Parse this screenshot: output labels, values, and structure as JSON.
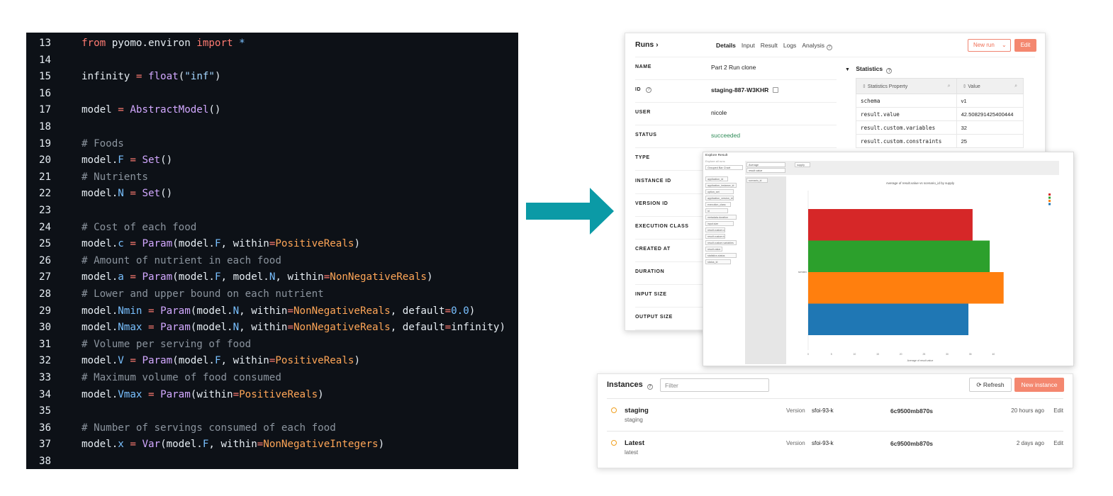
{
  "code": {
    "lines": [
      {
        "n": "13",
        "tokens": [
          [
            "kw",
            "from"
          ],
          [
            "pl",
            " pyomo.environ "
          ],
          [
            "kw",
            "import"
          ],
          [
            "pl",
            " "
          ],
          [
            "attr",
            "*"
          ]
        ]
      },
      {
        "n": "14",
        "tokens": []
      },
      {
        "n": "15",
        "tokens": [
          [
            "pl",
            "infinity "
          ],
          [
            "op",
            "="
          ],
          [
            "pl",
            " "
          ],
          [
            "fn",
            "float"
          ],
          [
            "pl",
            "("
          ],
          [
            "str",
            "\"inf\""
          ],
          [
            "pl",
            ")"
          ]
        ]
      },
      {
        "n": "16",
        "tokens": []
      },
      {
        "n": "17",
        "tokens": [
          [
            "pl",
            "model "
          ],
          [
            "op",
            "="
          ],
          [
            "pl",
            " "
          ],
          [
            "fn",
            "AbstractModel"
          ],
          [
            "pl",
            "()"
          ]
        ]
      },
      {
        "n": "18",
        "tokens": []
      },
      {
        "n": "19",
        "tokens": [
          [
            "cm",
            "# Foods"
          ]
        ]
      },
      {
        "n": "20",
        "tokens": [
          [
            "pl",
            "model."
          ],
          [
            "attr",
            "F"
          ],
          [
            "pl",
            " "
          ],
          [
            "op",
            "="
          ],
          [
            "pl",
            " "
          ],
          [
            "fn",
            "Set"
          ],
          [
            "pl",
            "()"
          ]
        ]
      },
      {
        "n": "21",
        "tokens": [
          [
            "cm",
            "# Nutrients"
          ]
        ]
      },
      {
        "n": "22",
        "tokens": [
          [
            "pl",
            "model."
          ],
          [
            "attr",
            "N"
          ],
          [
            "pl",
            " "
          ],
          [
            "op",
            "="
          ],
          [
            "pl",
            " "
          ],
          [
            "fn",
            "Set"
          ],
          [
            "pl",
            "()"
          ]
        ]
      },
      {
        "n": "23",
        "tokens": []
      },
      {
        "n": "24",
        "tokens": [
          [
            "cm",
            "# Cost of each food"
          ]
        ]
      },
      {
        "n": "25",
        "tokens": [
          [
            "pl",
            "model."
          ],
          [
            "attr",
            "c"
          ],
          [
            "pl",
            " "
          ],
          [
            "op",
            "="
          ],
          [
            "pl",
            " "
          ],
          [
            "fn",
            "Param"
          ],
          [
            "pl",
            "(model."
          ],
          [
            "attr",
            "F"
          ],
          [
            "pl",
            ", within"
          ],
          [
            "op",
            "="
          ],
          [
            "type",
            "PositiveReals"
          ],
          [
            "pl",
            ")"
          ]
        ]
      },
      {
        "n": "26",
        "tokens": [
          [
            "cm",
            "# Amount of nutrient in each food"
          ]
        ]
      },
      {
        "n": "27",
        "tokens": [
          [
            "pl",
            "model."
          ],
          [
            "attr",
            "a"
          ],
          [
            "pl",
            " "
          ],
          [
            "op",
            "="
          ],
          [
            "pl",
            " "
          ],
          [
            "fn",
            "Param"
          ],
          [
            "pl",
            "(model."
          ],
          [
            "attr",
            "F"
          ],
          [
            "pl",
            ", model."
          ],
          [
            "attr",
            "N"
          ],
          [
            "pl",
            ", within"
          ],
          [
            "op",
            "="
          ],
          [
            "type",
            "NonNegativeReals"
          ],
          [
            "pl",
            ")"
          ]
        ]
      },
      {
        "n": "28",
        "tokens": [
          [
            "cm",
            "# Lower and upper bound on each nutrient"
          ]
        ]
      },
      {
        "n": "29",
        "tokens": [
          [
            "pl",
            "model."
          ],
          [
            "attr",
            "Nmin"
          ],
          [
            "pl",
            " "
          ],
          [
            "op",
            "="
          ],
          [
            "pl",
            " "
          ],
          [
            "fn",
            "Param"
          ],
          [
            "pl",
            "(model."
          ],
          [
            "attr",
            "N"
          ],
          [
            "pl",
            ", within"
          ],
          [
            "op",
            "="
          ],
          [
            "type",
            "NonNegativeReals"
          ],
          [
            "pl",
            ", default"
          ],
          [
            "op",
            "="
          ],
          [
            "num",
            "0.0"
          ],
          [
            "pl",
            ")"
          ]
        ]
      },
      {
        "n": "30",
        "tokens": [
          [
            "pl",
            "model."
          ],
          [
            "attr",
            "Nmax"
          ],
          [
            "pl",
            " "
          ],
          [
            "op",
            "="
          ],
          [
            "pl",
            " "
          ],
          [
            "fn",
            "Param"
          ],
          [
            "pl",
            "(model."
          ],
          [
            "attr",
            "N"
          ],
          [
            "pl",
            ", within"
          ],
          [
            "op",
            "="
          ],
          [
            "type",
            "NonNegativeReals"
          ],
          [
            "pl",
            ", default"
          ],
          [
            "op",
            "="
          ],
          [
            "pl",
            "infinity)"
          ]
        ]
      },
      {
        "n": "31",
        "tokens": [
          [
            "cm",
            "# Volume per serving of food"
          ]
        ]
      },
      {
        "n": "32",
        "tokens": [
          [
            "pl",
            "model."
          ],
          [
            "attr",
            "V"
          ],
          [
            "pl",
            " "
          ],
          [
            "op",
            "="
          ],
          [
            "pl",
            " "
          ],
          [
            "fn",
            "Param"
          ],
          [
            "pl",
            "(model."
          ],
          [
            "attr",
            "F"
          ],
          [
            "pl",
            ", within"
          ],
          [
            "op",
            "="
          ],
          [
            "type",
            "PositiveReals"
          ],
          [
            "pl",
            ")"
          ]
        ]
      },
      {
        "n": "33",
        "tokens": [
          [
            "cm",
            "# Maximum volume of food consumed"
          ]
        ]
      },
      {
        "n": "34",
        "tokens": [
          [
            "pl",
            "model."
          ],
          [
            "attr",
            "Vmax"
          ],
          [
            "pl",
            " "
          ],
          [
            "op",
            "="
          ],
          [
            "pl",
            " "
          ],
          [
            "fn",
            "Param"
          ],
          [
            "pl",
            "(within"
          ],
          [
            "op",
            "="
          ],
          [
            "type",
            "PositiveReals"
          ],
          [
            "pl",
            ")"
          ]
        ]
      },
      {
        "n": "35",
        "tokens": []
      },
      {
        "n": "36",
        "tokens": [
          [
            "cm",
            "# Number of servings consumed of each food"
          ]
        ]
      },
      {
        "n": "37",
        "tokens": [
          [
            "pl",
            "model."
          ],
          [
            "attr",
            "x"
          ],
          [
            "pl",
            " "
          ],
          [
            "op",
            "="
          ],
          [
            "pl",
            " "
          ],
          [
            "fn",
            "Var"
          ],
          [
            "pl",
            "(model."
          ],
          [
            "attr",
            "F"
          ],
          [
            "pl",
            ", within"
          ],
          [
            "op",
            "="
          ],
          [
            "type",
            "NonNegativeIntegers"
          ],
          [
            "pl",
            ")"
          ]
        ]
      },
      {
        "n": "38",
        "tokens": []
      }
    ]
  },
  "arrow_color": "#0b9aa6",
  "runs": {
    "breadcrumb": "Runs",
    "tabs": [
      "Details",
      "Input",
      "Result",
      "Logs",
      "Analysis"
    ],
    "new_run_label": "New run",
    "edit_label": "Edit",
    "details": [
      {
        "label": "NAME",
        "value": "Part 2 Run clone"
      },
      {
        "label": "ID",
        "value": "staging-887-W3KHR"
      },
      {
        "label": "USER",
        "value": "nicole"
      },
      {
        "label": "STATUS",
        "value": "succeeded"
      },
      {
        "label": "TYPE",
        "value": ""
      },
      {
        "label": "INSTANCE ID",
        "value": ""
      },
      {
        "label": "VERSION ID",
        "value": ""
      },
      {
        "label": "EXECUTION CLASS",
        "value": ""
      },
      {
        "label": "CREATED AT",
        "value": ""
      },
      {
        "label": "DURATION",
        "value": ""
      },
      {
        "label": "INPUT SIZE",
        "value": ""
      },
      {
        "label": "OUTPUT SIZE",
        "value": ""
      }
    ],
    "statistics": {
      "title": "Statistics",
      "headers": [
        "Statistics Property",
        "Value"
      ],
      "rows": [
        [
          "schema",
          "v1"
        ],
        [
          "result.value",
          "42.508291425400444"
        ],
        [
          "result.custom.variables",
          "32"
        ],
        [
          "result.custom.constraints",
          "25"
        ]
      ]
    }
  },
  "explore": {
    "title": "Explore Result",
    "subtitle": "Explore all runs",
    "toolbar": {
      "agg": "Average",
      "field": "result.value",
      "group": "Grouped Bar Chart",
      "split": "supply",
      "scenario": "scenario_id"
    },
    "chips": [
      "application_id",
      "application_instance_id",
      "option_set",
      "application_version_id",
      "execution_class",
      "id",
      "metadata.duration",
      "input.size",
      "result.custom.constraints",
      "result.custom.total_grade",
      "result.custom.variables",
      "result.value",
      "statistics.status",
      "status_id"
    ],
    "chart_data": {
      "type": "bar",
      "title": "Average of result.value vs scenario_id by supply",
      "xlabel": "Average of result.value",
      "ylabel": "",
      "categories": [
        "scenario"
      ],
      "xlim": [
        0,
        45
      ],
      "x_ticks": [
        "0",
        "5",
        "10",
        "15",
        "20",
        "25",
        "30",
        "35",
        "40"
      ],
      "series": [
        {
          "name": "",
          "value": 35.5,
          "color": "#d62728"
        },
        {
          "name": "",
          "value": 39.2,
          "color": "#2ca02c"
        },
        {
          "name": "",
          "value": 42.2,
          "color": "#ff7f0e"
        },
        {
          "name": "",
          "value": 34.6,
          "color": "#1f77b4"
        }
      ]
    }
  },
  "instances": {
    "title": "Instances",
    "filter_placeholder": "Filter",
    "refresh_label": "Refresh",
    "new_label": "New instance",
    "rows": [
      {
        "name": "staging",
        "sub": "staging",
        "version_label": "Version",
        "version": "sfoi-93-k",
        "hash": "6c9500mb870s",
        "time": "20 hours ago",
        "edit": "Edit"
      },
      {
        "name": "Latest",
        "sub": "latest",
        "version_label": "Version",
        "version": "sfoi-93-k",
        "hash": "6c9500mb870s",
        "time": "2 days ago",
        "edit": "Edit"
      }
    ]
  }
}
